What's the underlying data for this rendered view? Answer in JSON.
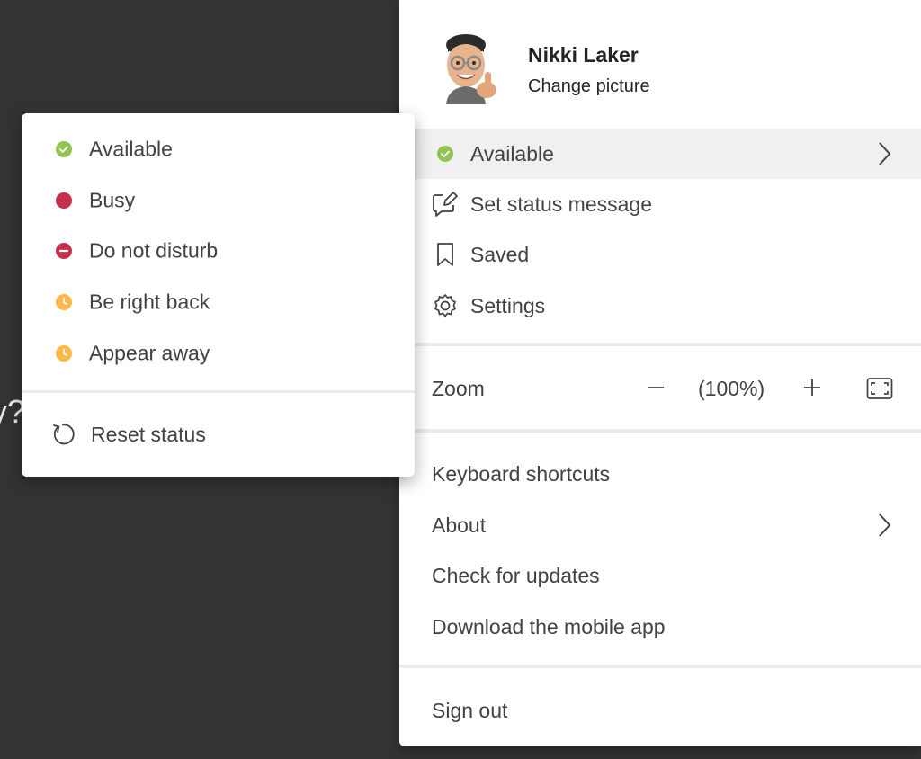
{
  "background": {
    "fragment_text": "y?"
  },
  "profile": {
    "name": "Nikki Laker",
    "change_picture": "Change picture"
  },
  "menu": {
    "status": {
      "label": "Available",
      "icon": "status-available-icon",
      "color": "#92c353"
    },
    "items": [
      {
        "label": "Set status message",
        "icon": "edit-message-icon"
      },
      {
        "label": "Saved",
        "icon": "bookmark-icon"
      },
      {
        "label": "Settings",
        "icon": "gear-icon"
      }
    ],
    "zoom": {
      "label": "Zoom",
      "value": "(100%)"
    },
    "links": [
      {
        "label": "Keyboard shortcuts"
      },
      {
        "label": "About"
      },
      {
        "label": "Check for updates"
      },
      {
        "label": "Download the mobile app"
      }
    ],
    "sign_out": "Sign out"
  },
  "status_menu": {
    "items": [
      {
        "label": "Available",
        "color": "#92c353",
        "icon": "check-icon"
      },
      {
        "label": "Busy",
        "color": "#c4314b",
        "icon": ""
      },
      {
        "label": "Do not disturb",
        "color": "#c4314b",
        "icon": "minus-icon"
      },
      {
        "label": "Be right back",
        "color": "#fcb84a",
        "icon": "clock-icon"
      },
      {
        "label": "Appear away",
        "color": "#fcb84a",
        "icon": "clock-icon"
      }
    ],
    "reset": "Reset status"
  }
}
